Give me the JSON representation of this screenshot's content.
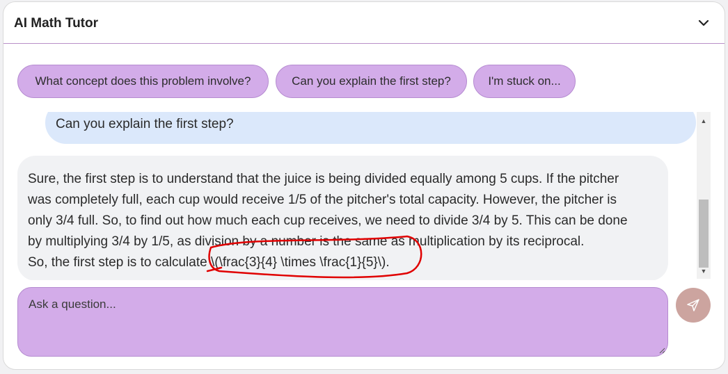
{
  "header": {
    "title": "AI Math Tutor",
    "collapse_icon": "chevron-down-icon"
  },
  "suggestions": [
    "What concept does this problem involve?",
    "Can you explain the first step?",
    "I'm stuck on..."
  ],
  "messages": {
    "user": "Can you explain the first step?",
    "assistant_lines": [
      "Sure, the first step is to understand that the juice is being divided equally among 5 cups. If the pitcher",
      "was completely full, each cup would receive 1/5 of the pitcher's total capacity. However, the pitcher is",
      "only 3/4 full. So, to find out how much each cup receives, we need to divide 3/4 by 5. This can be done",
      "by multiplying 3/4 by 1/5, as division by a number is the same as multiplication by its reciprocal.",
      "So, the first step is to calculate \\(\\frac{3}{4} \\times \\frac{1}{5}\\)."
    ]
  },
  "input": {
    "placeholder": "Ask a question...",
    "value": ""
  },
  "send": {
    "icon": "send-icon"
  },
  "colors": {
    "chip_bg": "#d3ace9",
    "user_bubble": "#dbe8fb",
    "ai_bubble": "#f1f2f4",
    "send_button": "#cca49f",
    "annotation": "#e00000"
  }
}
